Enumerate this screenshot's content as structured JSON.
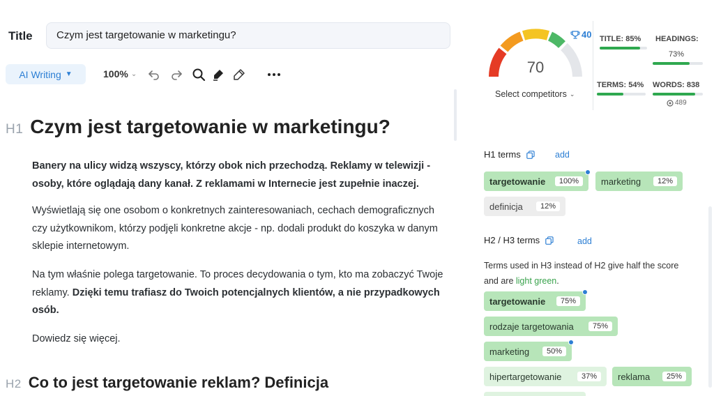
{
  "editor": {
    "title_label": "Title",
    "title_value": "Czym jest targetowanie w marketingu?",
    "toolbar": {
      "ai_writing_label": "AI Writing",
      "zoom_label": "100%"
    },
    "h1_tag": "H1",
    "h1_text": "Czym jest targetowanie w marketingu?",
    "para1_bold": "Banery na ulicy widzą wszyscy, którzy obok nich przechodzą. Reklamy w telewizji - osoby, które oglądają dany kanał. Z reklamami w Internecie jest zupełnie inaczej.",
    "para2": "Wyświetlają się one osobom o konkretnych zainteresowaniach, cechach demograficznych czy użytkownikom, którzy podjęli konkretne akcje - np. dodali produkt do koszyka w danym sklepie internetowym.",
    "para3_normal": "Na tym właśnie polega targetowanie. To proces decydowania o tym, kto ma zobaczyć Twoje reklamy. ",
    "para3_bold": "Dzięki temu trafiasz do Twoich potencjalnych klientów, a nie przypadkowych osób.",
    "para4": "Dowiedz się więcej.",
    "h2_tag": "H2",
    "h2_text": "Co to jest targetowanie reklam? Definicja"
  },
  "panel": {
    "score": "70",
    "score_fraction": 0.7,
    "trophy_value": "40",
    "select_competitors": "Select competitors",
    "metrics": {
      "title_label": "TITLE: 85%",
      "title_fraction": 0.85,
      "headings_label": "HEADINGS:",
      "headings_value": "73%",
      "headings_fraction": 0.73,
      "terms_label": "TERMS: 54%",
      "terms_fraction": 0.54,
      "words_label": "WORDS: 838",
      "words_fraction": 0.85,
      "words_sub": "489"
    },
    "h1_section": {
      "title": "H1 terms",
      "add": "add",
      "chips": [
        {
          "term": "targetowanie",
          "pct": "100%"
        },
        {
          "term": "marketing",
          "pct": "12%"
        },
        {
          "term": "definicja",
          "pct": "12%"
        }
      ]
    },
    "h2_section": {
      "title": "H2 / H3 terms",
      "add": "add",
      "note_prefix": "Terms used in H3 instead of H2 give half the score and are ",
      "note_highlight": "light green",
      "note_suffix": ".",
      "chips": [
        {
          "term": "targetowanie",
          "pct": "75%"
        },
        {
          "term": "rodzaje targetowania",
          "pct": "75%"
        },
        {
          "term": "marketing",
          "pct": "50%"
        },
        {
          "term": "hipertargetowanie",
          "pct": "37%"
        },
        {
          "term": "reklama",
          "pct": "25%"
        }
      ]
    },
    "colors": {
      "accent": "#2d7fd4",
      "green_chip": "#b7e5b9",
      "light_green_chip": "#dff3e0",
      "bar_green": "#2fa84f"
    }
  }
}
